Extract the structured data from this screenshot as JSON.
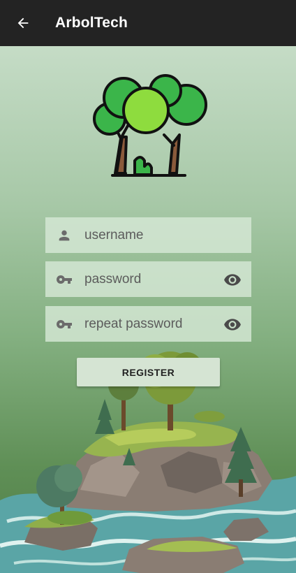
{
  "app": {
    "title": "ArbolTech"
  },
  "form": {
    "username_placeholder": "username",
    "password_placeholder": "password",
    "repeat_password_placeholder": "repeat password",
    "register_label": "REGISTER"
  },
  "icons": {
    "back": "arrow-left-icon",
    "user": "person-icon",
    "key": "key-icon",
    "visibility": "eye-icon"
  },
  "colors": {
    "appbar": "#232323",
    "field_bg": "#d6e8d5",
    "button_bg": "#d5e4d3",
    "gradient_top": "#c5dcc6",
    "gradient_bottom": "#4f7d46"
  }
}
